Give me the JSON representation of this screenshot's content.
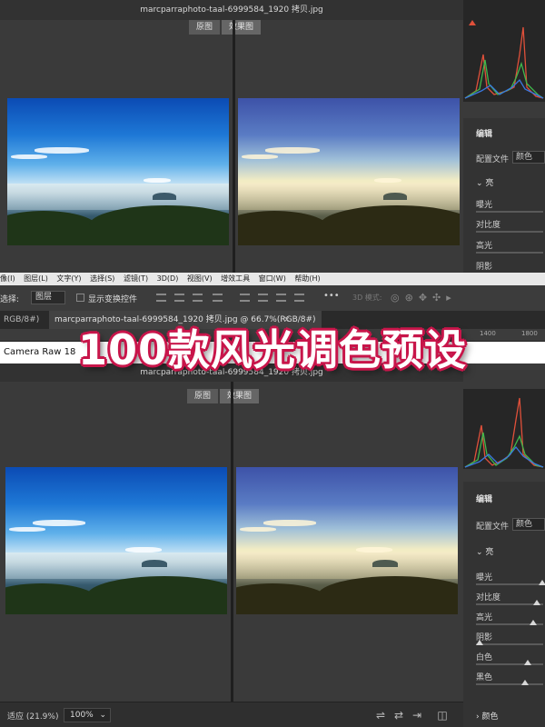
{
  "window_title": "marcparraphoto-taal-6999584_1920 拷贝.jpg",
  "view_tabs": {
    "original": "原图",
    "effect": "效果图"
  },
  "edit_panel": {
    "heading": "编辑",
    "profile_label": "配置文件",
    "profile_value": "颜色",
    "light_section": "亮",
    "top_sliders": [
      {
        "label": "曝光",
        "value": 0.72
      },
      {
        "label": "对比度",
        "value": 0.55
      },
      {
        "label": "高光",
        "value": 0.45
      },
      {
        "label": "阴影",
        "value": 0.62
      }
    ],
    "bottom_sliders": [
      {
        "label": "曝光",
        "value": 0.98
      },
      {
        "label": "对比度",
        "value": 0.9
      },
      {
        "label": "高光",
        "value": 0.84
      },
      {
        "label": "阴影",
        "value": 0.0
      },
      {
        "label": "白色",
        "value": 0.76
      },
      {
        "label": "黑色",
        "value": 0.72
      }
    ],
    "color_section": "颜色"
  },
  "menubar": {
    "items": [
      "像(I)",
      "图层(L)",
      "文字(Y)",
      "选择(S)",
      "滤镜(T)",
      "3D(D)",
      "视图(V)",
      "增效工具",
      "窗口(W)",
      "帮助(H)"
    ]
  },
  "options_bar": {
    "select_label": "选择:",
    "select_value": "图层",
    "transform_label": "显示变换控件",
    "mode_3d": "3D 模式:",
    "more": "•••"
  },
  "doc_tabs": {
    "partial": "RGB/8#)",
    "active": "marcparraphoto-taal-6999584_1920 拷贝.jpg @ 66.7%(RGB/8#)",
    "close": "×"
  },
  "ruler": {
    "a": "1400",
    "b": "1800"
  },
  "camera_raw_label": "Camera Raw 18",
  "headline": "100款风光调色预设",
  "status_bar": {
    "fit": "适应 (21.9%)",
    "zoom": "100%"
  },
  "colors": {
    "headline_stroke": "#c8154a",
    "panel": "#3a3a3a",
    "histogram_red": "#e0503a",
    "histogram_green": "#3fb84c",
    "histogram_blue": "#3a78e0"
  }
}
